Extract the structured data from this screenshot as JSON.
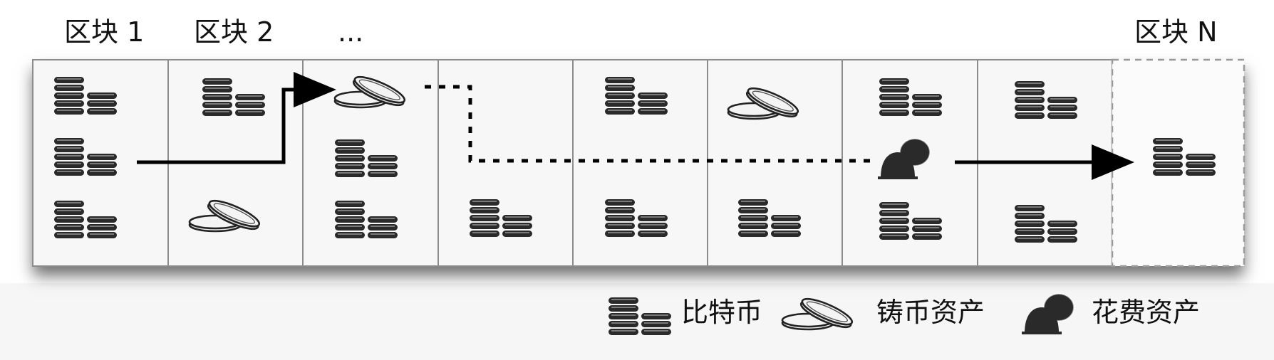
{
  "headers": {
    "block1": "区块 1",
    "block2": "区块 2",
    "ellipsis": "...",
    "blockN": "区块 N"
  },
  "legend": {
    "bitcoin": {
      "icon": "bitcoin-coin-stack-icon",
      "label": "比特币"
    },
    "minted": {
      "icon": "minted-asset-coins-icon",
      "label": "铸币资产"
    },
    "spent": {
      "icon": "spent-asset-icon",
      "label": "花费资产"
    }
  },
  "blocks": [
    {
      "slots": [
        "bitcoin",
        "bitcoin",
        "bitcoin"
      ]
    },
    {
      "slots": [
        "bitcoin",
        "none",
        "minted"
      ]
    },
    {
      "slots": [
        "minted",
        "bitcoin",
        "bitcoin"
      ]
    },
    {
      "slots": [
        "none",
        "none",
        "bitcoin"
      ]
    },
    {
      "slots": [
        "bitcoin",
        "none",
        "bitcoin"
      ]
    },
    {
      "slots": [
        "minted",
        "none",
        "bitcoin"
      ]
    },
    {
      "slots": [
        "bitcoin",
        "spent",
        "bitcoin"
      ]
    },
    {
      "slots": [
        "bitcoin",
        "none",
        "bitcoin"
      ]
    },
    {
      "slots": [
        "none",
        "bitcoin",
        "none"
      ],
      "style": "dashed"
    }
  ],
  "colors": {
    "block_fill": "#f7f7f7",
    "block_border": "#8c8c8c",
    "icon_dark": "#2a2a2a",
    "coin_fill": "#ededed",
    "arrow": "#000000"
  }
}
